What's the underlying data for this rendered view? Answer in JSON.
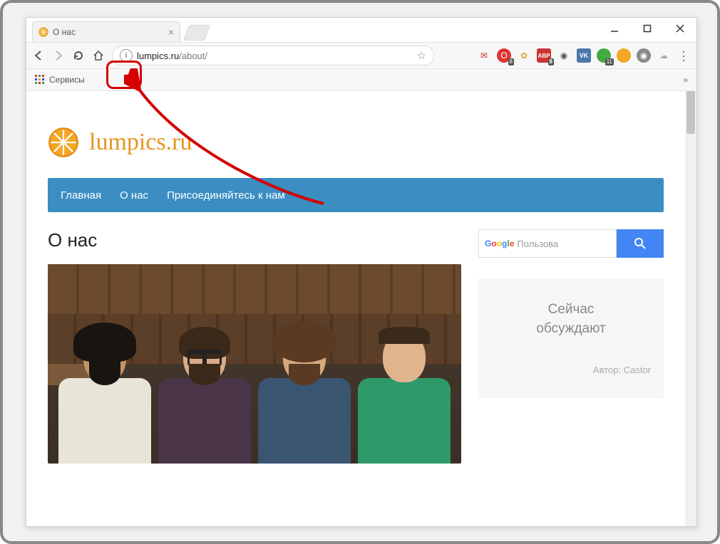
{
  "window": {
    "tab_title": "О нас"
  },
  "toolbar": {
    "url_host": "lumpics.ru",
    "url_path": "/about/",
    "bookmark_label": "Сервисы",
    "extensions": {
      "opera_badge": "8",
      "abp_label": "ABP",
      "abp_badge": "8",
      "vk_label": "VK",
      "green_badge": "11"
    }
  },
  "page": {
    "logo_text": "lumpics.ru",
    "nav": {
      "home": "Главная",
      "about": "О нас",
      "join": "Присоединяйтесь к нам"
    },
    "heading": "О нас",
    "search_placeholder": "Пользова",
    "sidebar_title_1": "Сейчас",
    "sidebar_title_2": "обсуждают",
    "author_label": "Автор: Castor"
  }
}
